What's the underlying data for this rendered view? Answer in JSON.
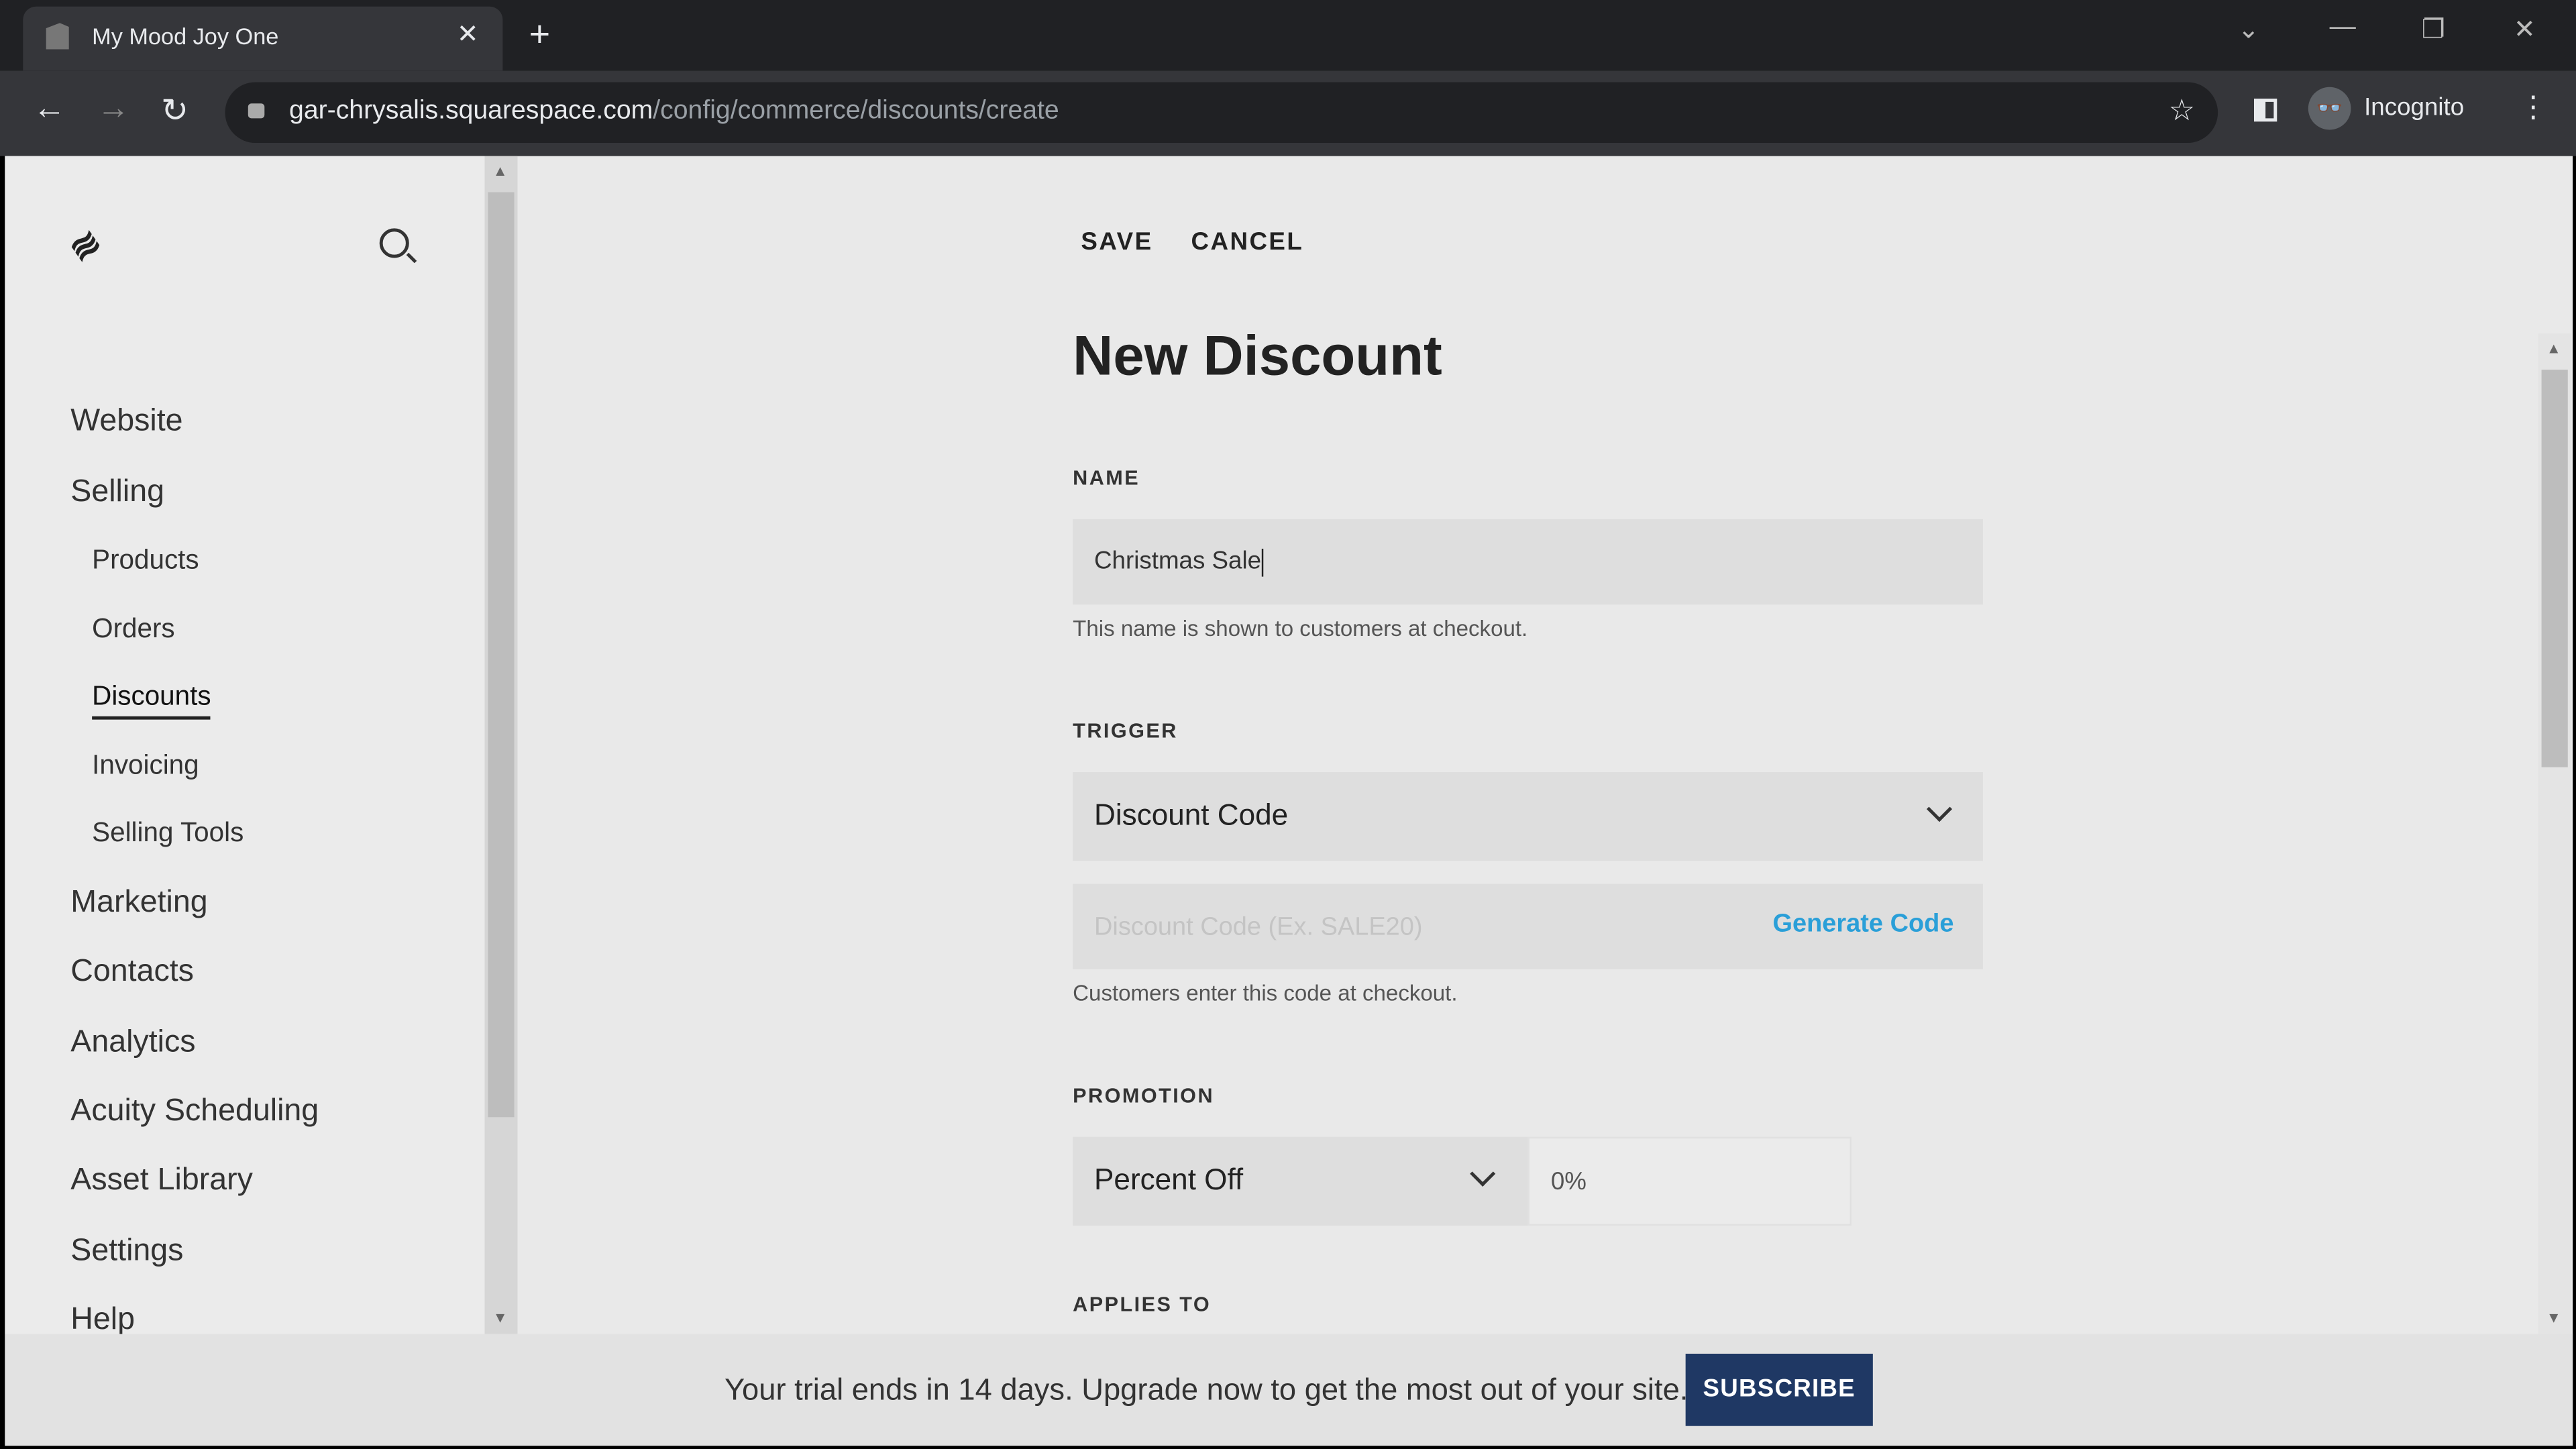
{
  "browser": {
    "tab_title": "My Mood Joy One",
    "url_domain": "gar-chrysalis.squarespace.com",
    "url_path": "/config/commerce/discounts/create",
    "profile_label": "Incognito"
  },
  "sidebar": {
    "items": [
      {
        "label": "Website"
      },
      {
        "label": "Selling",
        "children": [
          {
            "label": "Products"
          },
          {
            "label": "Orders"
          },
          {
            "label": "Discounts",
            "active": true
          },
          {
            "label": "Invoicing"
          },
          {
            "label": "Selling Tools"
          }
        ]
      },
      {
        "label": "Marketing"
      },
      {
        "label": "Contacts"
      },
      {
        "label": "Analytics"
      },
      {
        "label": "Acuity Scheduling"
      },
      {
        "label": "Asset Library"
      },
      {
        "label": "Settings"
      },
      {
        "label": "Help"
      }
    ]
  },
  "header": {
    "save": "SAVE",
    "cancel": "CANCEL",
    "title": "New Discount"
  },
  "form": {
    "name": {
      "label": "NAME",
      "value": "Christmas Sale",
      "help": "This name is shown to customers at checkout."
    },
    "trigger": {
      "label": "TRIGGER",
      "value": "Discount Code",
      "code_placeholder": "Discount Code (Ex. SALE20)",
      "generate": "Generate Code",
      "help": "Customers enter this code at checkout."
    },
    "promotion": {
      "label": "PROMOTION",
      "type": "Percent Off",
      "amount_placeholder": "0%"
    },
    "applies_to": {
      "label": "APPLIES TO"
    }
  },
  "banner": {
    "message": "Your trial ends in 14 days. Upgrade now to get the most out of your site.",
    "button": "SUBSCRIBE"
  },
  "colors": {
    "accent": "#2a9fd8",
    "subscribe": "#1f3864"
  }
}
